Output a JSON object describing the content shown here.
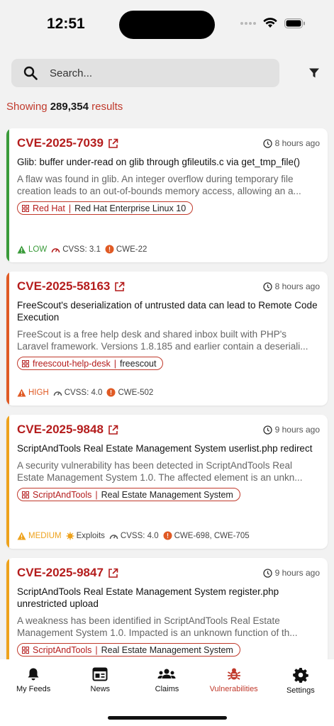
{
  "status": {
    "time": "12:51"
  },
  "search": {
    "placeholder": "Search..."
  },
  "results": {
    "prefix": "Showing",
    "count": "289,354",
    "suffix": "results"
  },
  "colors": {
    "accent": "#b41c1c",
    "low": "#3a9b3a",
    "high": "#e05a24",
    "medium": "#eea21c"
  },
  "cards": [
    {
      "id": "CVE-2025-7039",
      "time": "8 hours ago",
      "title": "Glib: buffer under-read on glib through gfileutils.c via get_tmp_file()",
      "desc_l1": "A flaw was found in glib. An integer overflow during temporary file",
      "desc_l2": "creation leads to an out-of-bounds memory access, allowing an a...",
      "vendor": "Red Hat",
      "product": "Red Hat Enterprise Linux 10",
      "severity": "LOW",
      "cvss": "CVSS: 3.1",
      "cwe": "CWE-22"
    },
    {
      "id": "CVE-2025-58163",
      "time": "8 hours ago",
      "title": "FreeScout's deserialization of untrusted data can lead to Remote Code Execution",
      "desc_l1": "FreeScout is a free help desk and shared inbox built with PHP's",
      "desc_l2": "Laravel framework. Versions 1.8.185 and earlier contain a deseriali...",
      "vendor": "freescout-help-desk",
      "product": "freescout",
      "severity": "HIGH",
      "cvss": "CVSS: 4.0",
      "cwe": "CWE-502"
    },
    {
      "id": "CVE-2025-9848",
      "time": "9 hours ago",
      "title": "ScriptAndTools Real Estate Management System userlist.php redirect",
      "desc_l1": "A security vulnerability has been detected in ScriptAndTools Real",
      "desc_l2": "Estate Management System 1.0. The affected element is an unkn...",
      "vendor": "ScriptAndTools",
      "product": "Real Estate Management System",
      "severity": "MEDIUM",
      "exploits": "Exploits",
      "cvss": "CVSS: 4.0",
      "cwe": "CWE-698, CWE-705"
    },
    {
      "id": "CVE-2025-9847",
      "time": "9 hours ago",
      "title": "ScriptAndTools Real Estate Management System register.php unrestricted upload",
      "desc_l1": "A weakness has been identified in ScriptAndTools Real Estate",
      "desc_l2": "Management System 1.0. Impacted is an unknown function of th...",
      "vendor": "ScriptAndTools",
      "product": "Real Estate Management System"
    }
  ],
  "tabs": [
    {
      "label": "My Feeds",
      "icon": "bell-icon"
    },
    {
      "label": "News",
      "icon": "newspaper-icon"
    },
    {
      "label": "Claims",
      "icon": "users-icon"
    },
    {
      "label": "Vulnerabilities",
      "icon": "bug-icon",
      "active": true
    },
    {
      "label": "Settings",
      "icon": "gear-icon"
    }
  ]
}
